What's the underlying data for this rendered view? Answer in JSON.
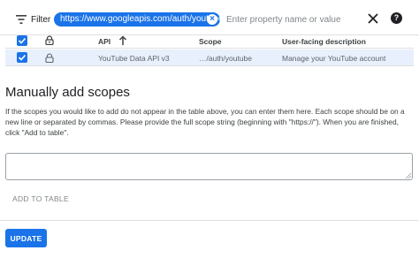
{
  "filter": {
    "label": "Filter",
    "chip_value": "https://www.googleapis.com/auth/youtube",
    "property_placeholder": "Enter property name or value",
    "icons": [
      "filter-icon",
      "close-icon",
      "help-icon"
    ]
  },
  "table": {
    "columns": [
      "API",
      "Scope",
      "User-facing description"
    ],
    "sort_column": "API",
    "rows": [
      {
        "selected": true,
        "locked": true,
        "api": "YouTube Data API v3",
        "scope": "…/auth/youtube",
        "description": "Manage your YouTube account"
      }
    ]
  },
  "manual": {
    "title": "Manually add scopes",
    "description": "If the scopes you would like to add do not appear in the table above, you can enter them here. Each scope should be on a new line or separated by commas. Please provide the full scope string (beginning with \"https://\"). When you are finished, click \"Add to table\".",
    "input_value": "",
    "add_button": "ADD TO TABLE"
  },
  "footer": {
    "update_button": "UPDATE"
  },
  "colors": {
    "accent": "#1a73e8",
    "row_highlight": "#e8f0fe",
    "border": "#e0e0e0",
    "disabled_text": "#80868b"
  }
}
